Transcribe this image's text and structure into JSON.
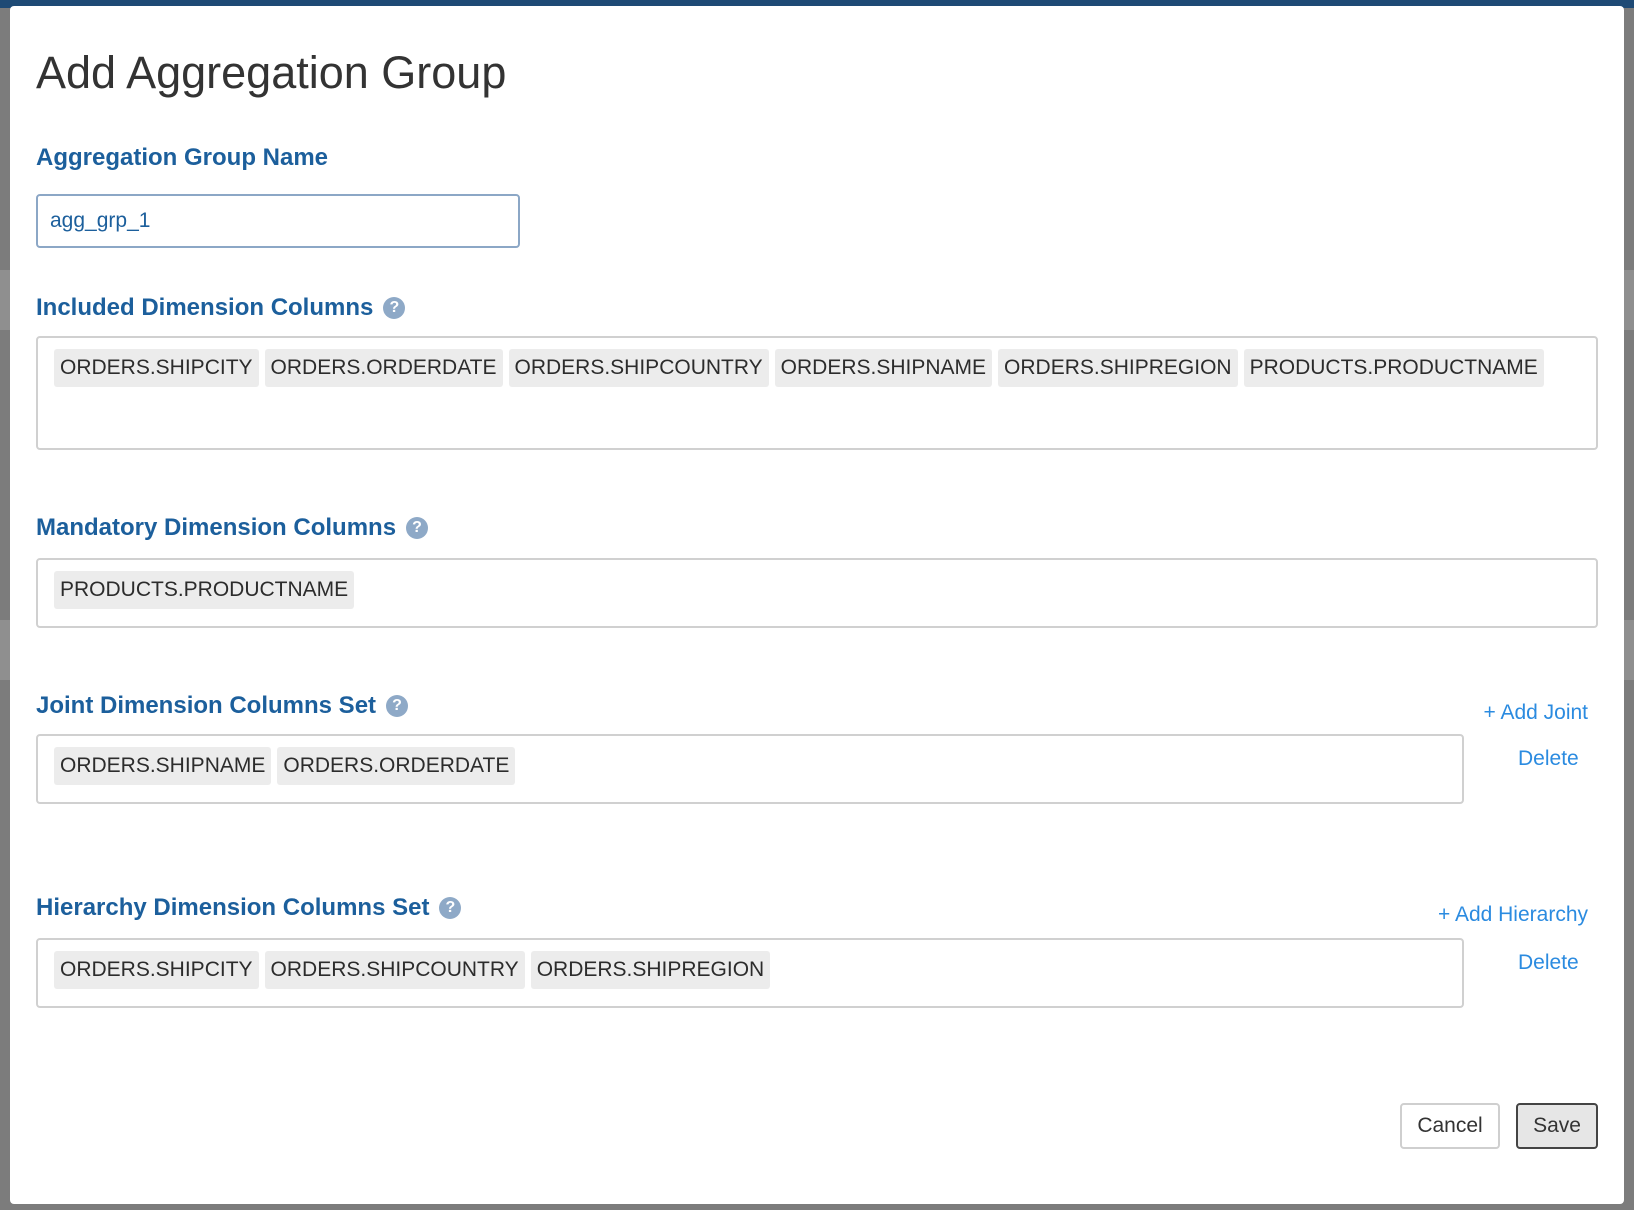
{
  "modal": {
    "title": "Add Aggregation Group",
    "group_name": {
      "label": "Aggregation Group Name",
      "value": "agg_grp_1"
    },
    "included": {
      "label": "Included Dimension Columns",
      "tags": [
        "ORDERS.SHIPCITY",
        "ORDERS.ORDERDATE",
        "ORDERS.SHIPCOUNTRY",
        "ORDERS.SHIPNAME",
        "ORDERS.SHIPREGION",
        "PRODUCTS.PRODUCTNAME"
      ]
    },
    "mandatory": {
      "label": "Mandatory Dimension Columns",
      "tags": [
        "PRODUCTS.PRODUCTNAME"
      ]
    },
    "joint": {
      "label": "Joint Dimension Columns Set",
      "add_label": "+ Add Joint",
      "delete_label": "Delete",
      "tags": [
        "ORDERS.SHIPNAME",
        "ORDERS.ORDERDATE"
      ]
    },
    "hierarchy": {
      "label": "Hierarchy Dimension Columns Set",
      "add_label": "+ Add Hierarchy",
      "delete_label": "Delete",
      "tags": [
        "ORDERS.SHIPCITY",
        "ORDERS.SHIPCOUNTRY",
        "ORDERS.SHIPREGION"
      ]
    },
    "buttons": {
      "cancel": "Cancel",
      "save": "Save"
    },
    "help_icon_glyph": "?"
  }
}
